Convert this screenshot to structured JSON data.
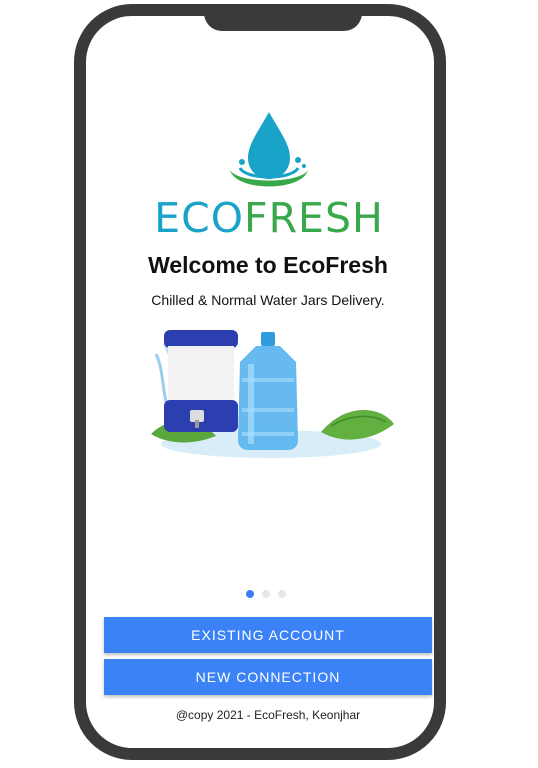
{
  "brand": {
    "logo_part1": "ECO",
    "logo_part2": "FRESH"
  },
  "welcome": {
    "title": "Welcome to EcoFresh",
    "subtitle": "Chilled & Normal Water Jars Delivery."
  },
  "carousel": {
    "page_count": 3,
    "active_page": 1
  },
  "buttons": {
    "existing_account": "EXISTING ACCOUNT",
    "new_connection": "NEW CONNECTION"
  },
  "footer": {
    "text": "@copy 2021 - EcoFresh, Keonjhar"
  },
  "colors": {
    "primary_button": "#3b82f6",
    "logo_blue": "#1aa3c8",
    "logo_green": "#38a84a",
    "frame": "#3a3a3a"
  },
  "icons": {
    "logo_mark": "water-drop-icon",
    "hero": "water-dispenser-and-jar-image"
  }
}
